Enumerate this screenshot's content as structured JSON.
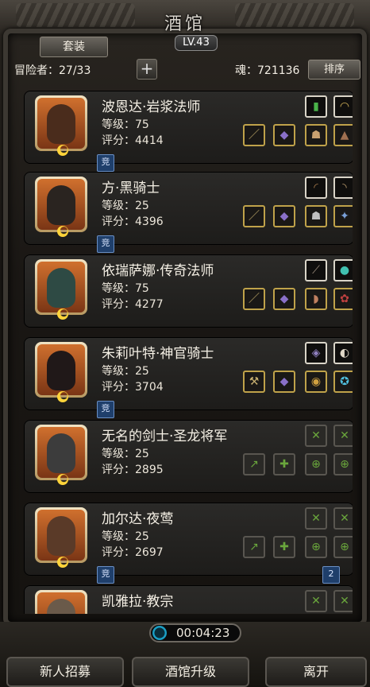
{
  "header": {
    "title": "酒馆",
    "level": "LV.43",
    "tab_label": "套装"
  },
  "stats": {
    "adventurers": "冒险者：27/33",
    "plus": "+",
    "soul": "魂：721136",
    "sort_label": "排序"
  },
  "heroes": [
    {
      "name": "波恩达·岩浆法师",
      "level": "等级：75",
      "score": "评分：4414",
      "tag": "竞"
    },
    {
      "name": "方·黑骑士",
      "level": "等级：25",
      "score": "评分：4396",
      "tag": "竞"
    },
    {
      "name": "依瑞萨娜·传奇法师",
      "level": "等级：75",
      "score": "评分：4277"
    },
    {
      "name": "朱莉叶特·神官骑士",
      "level": "等级：25",
      "score": "评分：3704",
      "tag": "竞"
    },
    {
      "name": "无名的剑士·圣龙将军",
      "level": "等级：25",
      "score": "评分：2895"
    },
    {
      "name": "加尔达·夜莺",
      "level": "等级：25",
      "score": "评分：2697",
      "tag": "竞",
      "badge": "2"
    },
    {
      "name": "凯雅拉·教宗"
    }
  ],
  "timer": {
    "time": "00:04:23"
  },
  "buttons": {
    "recruit": "新人招募",
    "upgrade": "酒馆升级",
    "leave": "离开"
  }
}
